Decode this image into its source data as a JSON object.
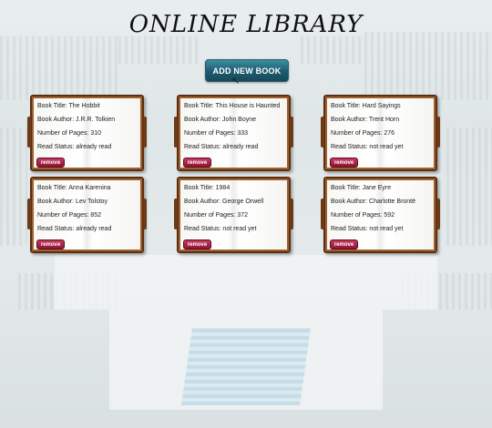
{
  "page": {
    "title": "ONLINE LIBRARY"
  },
  "toolbar": {
    "add_label": "ADD NEW BOOK"
  },
  "labels": {
    "title": "Book Title:",
    "author": "Book Author:",
    "pages": "Number of Pages:",
    "status": "Read Status:",
    "remove": "remove"
  },
  "books": [
    {
      "title": "The Hobbit",
      "author": "J.R.R. Tolkien",
      "pages": "310",
      "status": "already read"
    },
    {
      "title": "This House is Haunted",
      "author": "John Boyne",
      "pages": "333",
      "status": "already read"
    },
    {
      "title": "Hard Sayings",
      "author": "Trent Horn",
      "pages": "276",
      "status": "not read yet"
    },
    {
      "title": "Anna Karenina",
      "author": "Lev Tolstoy",
      "pages": "852",
      "status": "already read"
    },
    {
      "title": "1984",
      "author": "George Orwell",
      "pages": "372",
      "status": "not read yet"
    },
    {
      "title": "Jane Eyre",
      "author": "Charlotte Brontë",
      "pages": "592",
      "status": "not read yet"
    }
  ],
  "colors": {
    "button": "#1f5d72",
    "remove": "#8e1436",
    "book_border": "#5b2d12"
  }
}
